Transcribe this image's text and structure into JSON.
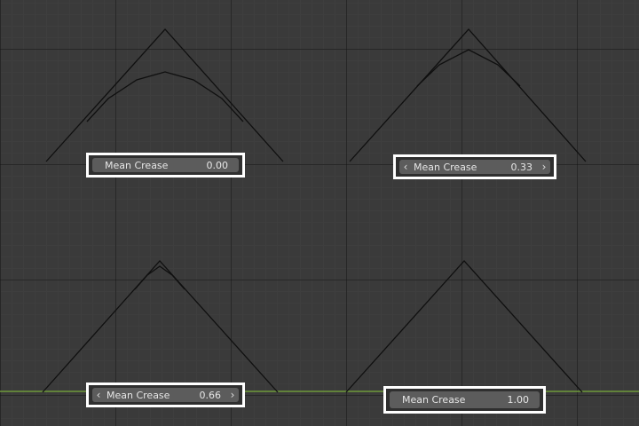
{
  "viewport": {
    "background": "#3a3a3a",
    "x_axis_color": "#6e9a3a",
    "curve_color": "#0f0f0f"
  },
  "crease_fields": [
    {
      "label": "Mean Crease",
      "value": "0.00",
      "arrows": false,
      "state": "normal"
    },
    {
      "label": "Mean Crease",
      "value": "0.33",
      "arrows": true,
      "state": "hover"
    },
    {
      "label": "Mean Crease",
      "value": "0.66",
      "arrows": true,
      "state": "hover"
    },
    {
      "label": "Mean Crease",
      "value": "1.00",
      "arrows": false,
      "state": "normal"
    }
  ],
  "arrow_glyphs": {
    "left": "‹",
    "right": "›"
  }
}
